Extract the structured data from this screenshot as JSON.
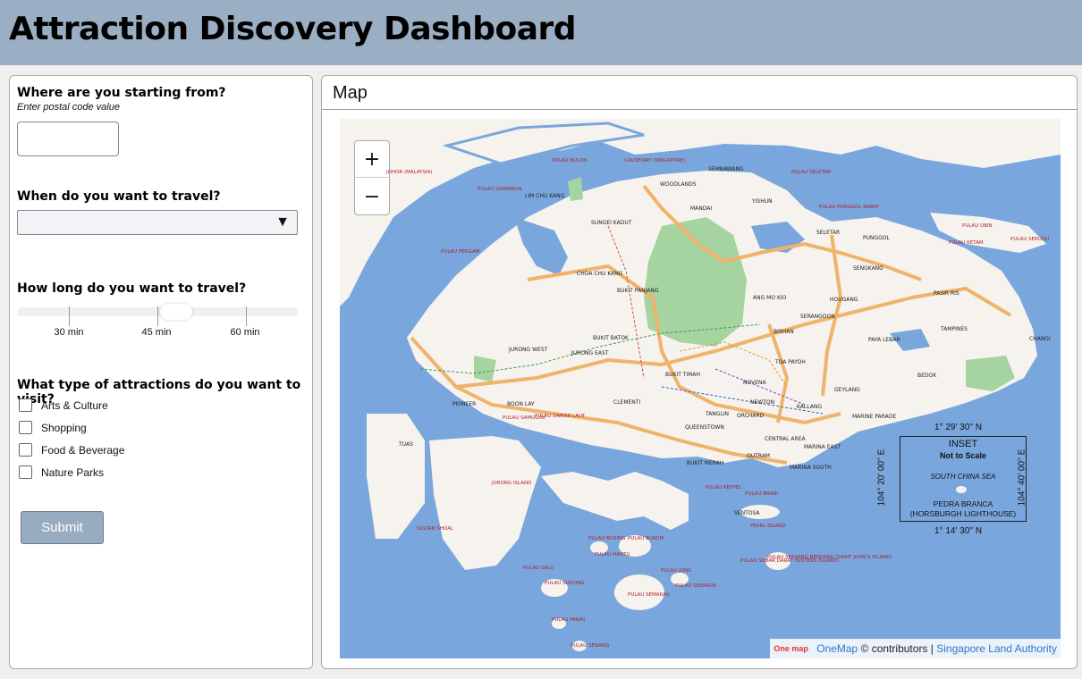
{
  "header": {
    "title": "Attraction Discovery Dashboard"
  },
  "form": {
    "start_question": "Where are you starting from?",
    "start_hint": "Enter postal code value",
    "postal_value": "",
    "when_question": "When do you want to travel?",
    "when_selected": "",
    "duration_question": "How long do you want to travel?",
    "duration_ticks": [
      "30 min",
      "45 min",
      "60 min"
    ],
    "duration_value": "45 min",
    "type_question": "What type of attractions do you want to visit?",
    "types": [
      {
        "label": "Arts & Culture",
        "checked": false
      },
      {
        "label": "Shopping",
        "checked": false
      },
      {
        "label": "Food & Beverage",
        "checked": false
      },
      {
        "label": "Nature Parks",
        "checked": false
      }
    ],
    "submit_label": "Submit"
  },
  "map": {
    "title": "Map",
    "zoom_in": "+",
    "zoom_out": "−",
    "attribution": {
      "logo": "One map",
      "onemap": "OneMap",
      "contributors": "© contributors |",
      "sla": "Singapore Land Authority"
    },
    "inset": {
      "title": "INSET",
      "note": "Not to Scale",
      "sea": "SOUTH CHINA SEA",
      "place": "PEDRA BRANCA",
      "place2": "(HORSBURGH LIGHTHOUSE)",
      "lat_top": "1° 29' 30'' N",
      "lat_bottom": "1° 14' 30'' N",
      "lon_left": "104° 20' 00'' E",
      "lon_right": "104° 40' 00'' E"
    },
    "areas": [
      "WOODLANDS",
      "MANDAI",
      "SEMBAWANG",
      "YISHUN",
      "SUNGEI KADUT",
      "LIM CHU KANG",
      "CHOA CHU KANG",
      "BUKIT PANJANG",
      "ANG MO KIO",
      "HOUGANG",
      "SENGKANG",
      "PUNGGOL",
      "SELETAR",
      "PASIR RIS",
      "TAMPINES",
      "CHANGI",
      "BEDOK",
      "PAYA LEBAR",
      "SERANGOON",
      "BISHAN",
      "TOA PAYOH",
      "NOVENA",
      "GEYLANG",
      "KALLANG",
      "MARINE PARADE",
      "NEWTON",
      "ORCHARD",
      "TANGLIN",
      "QUEENSTOWN",
      "BUKIT TIMAH",
      "BUKIT BATOK",
      "JURONG WEST",
      "JURONG EAST",
      "CLEMENTI",
      "BOON LAY",
      "PIONEER",
      "TUAS",
      "BUKIT MERAH",
      "OUTRAM",
      "CENTRAL AREA",
      "MARINA EAST",
      "MARINA SOUTH",
      "SENTOSA"
    ],
    "islands": [
      "PULAU BULON",
      "CAUSEWAY (SINGAPORE)",
      "PULAU SARIMBUN",
      "PULAU SELETAR",
      "PULAU PUNGGOL BARAT",
      "PULAU UBIN",
      "PULAU SERUDU",
      "PULAU KETAM",
      "PULAU PERGAM",
      "JOHOR (MALAYSIA)",
      "PULAU SAMULUN",
      "PULAU DAMAR LAUT",
      "JURONG ISLAND",
      "PULAU KEPPEL",
      "PULAU BRANI",
      "PEARL ISLAND",
      "SULTAN SHOAL",
      "PULAU BUSING",
      "PULAU BUKOM",
      "PULAU HANTU",
      "PULAU SALU",
      "PULAU SUDONG",
      "PULAU SEMAKAU",
      "PULAU JONG",
      "PULAU SEBAROK",
      "PULAU SUBAR DARAT (SISTERS ISLAND)",
      "PULAU SEKIJANG BENDERA (SAINT JOHN'S ISLAND)",
      "PULAU PAWAI",
      "PULAU SENANG"
    ]
  }
}
